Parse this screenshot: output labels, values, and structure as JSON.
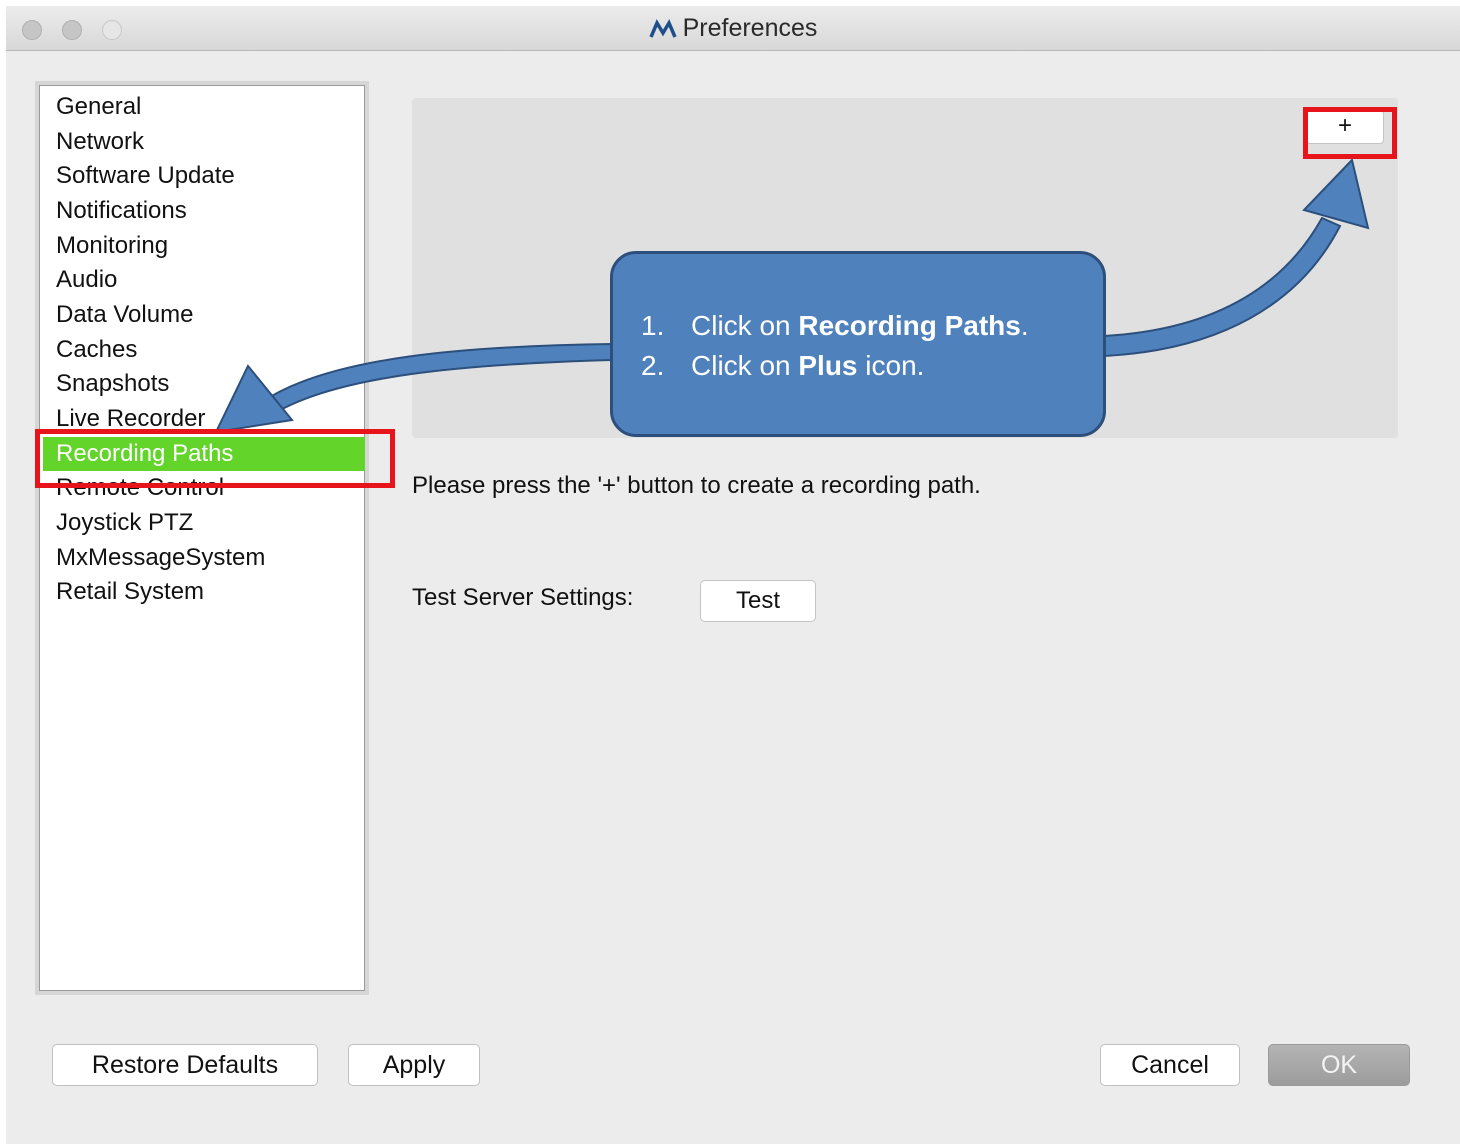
{
  "window": {
    "title": "Preferences",
    "traffic_lights": [
      "close",
      "minimize",
      "zoom"
    ]
  },
  "sidebar": {
    "items": [
      {
        "label": "General"
      },
      {
        "label": "Network"
      },
      {
        "label": "Software Update"
      },
      {
        "label": "Notifications"
      },
      {
        "label": "Monitoring"
      },
      {
        "label": "Audio"
      },
      {
        "label": "Data Volume"
      },
      {
        "label": "Caches"
      },
      {
        "label": "Snapshots"
      },
      {
        "label": "Live Recorder"
      },
      {
        "label": "Recording Paths",
        "selected": true
      },
      {
        "label": "Remote Control"
      },
      {
        "label": "Joystick PTZ"
      },
      {
        "label": "MxMessageSystem"
      },
      {
        "label": "Retail System"
      }
    ],
    "selected_color": "#62d42a"
  },
  "main": {
    "add_button_label": "+",
    "hint_text": "Please press the '+' button to create a recording path.",
    "test_label": "Test Server Settings:",
    "test_button_label": "Test"
  },
  "footer": {
    "restore_defaults_label": "Restore Defaults",
    "apply_label": "Apply",
    "cancel_label": "Cancel",
    "ok_label": "OK"
  },
  "annotation": {
    "steps": [
      {
        "number": "1.",
        "before": "Click on ",
        "bold": "Recording Paths",
        "after": "."
      },
      {
        "number": "2.",
        "before": "Click on ",
        "bold": "Plus",
        "after": " icon."
      }
    ],
    "callout_color": "#4f81bd",
    "highlight_color": "#e8141b"
  }
}
